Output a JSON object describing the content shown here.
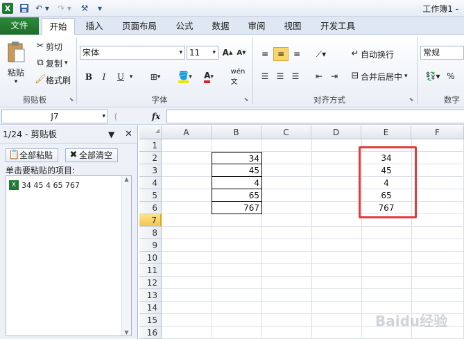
{
  "window": {
    "title": "工作簿1 -"
  },
  "ribbon_tabs": [
    "文件",
    "开始",
    "插入",
    "页面布局",
    "公式",
    "数据",
    "审阅",
    "视图",
    "开发工具"
  ],
  "clipboard_group": {
    "paste": "粘贴",
    "cut": "剪切",
    "copy": "复制",
    "format_painter": "格式刷",
    "label": "剪贴板"
  },
  "font_group": {
    "font_name": "宋体",
    "font_size": "11",
    "label": "字体",
    "bold": "B",
    "italic": "I",
    "underline": "U"
  },
  "alignment_group": {
    "wrap_text": "自动换行",
    "merge_center": "合并后居中",
    "label": "对齐方式"
  },
  "number_group": {
    "format": "常规",
    "label": "数字",
    "percent": "%"
  },
  "formula_bar": {
    "name_box": "J7",
    "fx": "fx",
    "value": ""
  },
  "clipboard_pane": {
    "title": "1/24 - 剪贴板",
    "paste_all": "全部粘贴",
    "clear_all": "全部清空",
    "instruction": "单击要粘贴的项目:",
    "items": [
      "34 45 4 65 767"
    ]
  },
  "sheet": {
    "columns": [
      "A",
      "B",
      "C",
      "D",
      "E",
      "F"
    ],
    "rows": [
      "1",
      "2",
      "3",
      "4",
      "5",
      "6",
      "7",
      "8",
      "9",
      "10",
      "11",
      "12",
      "13",
      "14",
      "15",
      "16"
    ],
    "selected_row": "7",
    "col_b": [
      "34",
      "45",
      "4",
      "65",
      "767"
    ],
    "col_e": [
      "34",
      "45",
      "4",
      "65",
      "767"
    ]
  },
  "watermark": "Baidu经验",
  "colors": {
    "file_tab": "#1e6b2a",
    "highlight_box": "#e53a3a",
    "selected_header": "#f9d66a"
  }
}
